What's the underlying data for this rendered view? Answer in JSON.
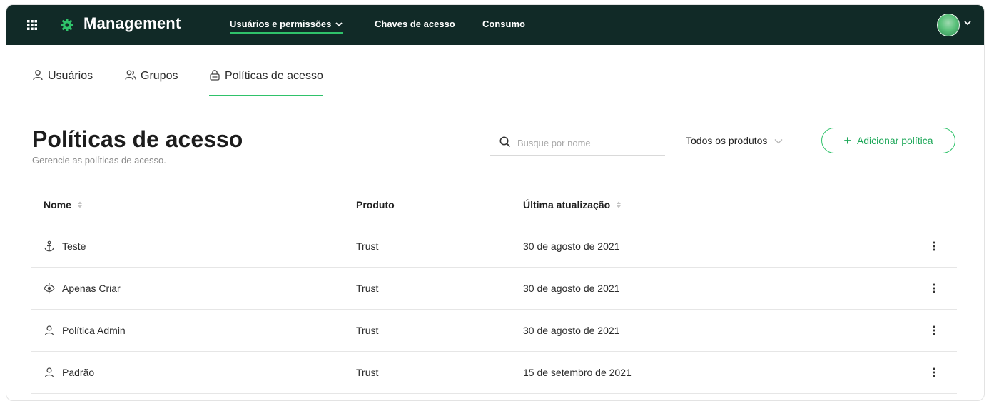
{
  "topbar": {
    "brand": "Management",
    "nav": [
      "Usuários e permissões",
      "Chaves de acesso",
      "Consumo"
    ],
    "colors": {
      "background": "#112a27",
      "accent": "#2fc26a"
    }
  },
  "subtabs": [
    {
      "label": "Usuários",
      "icon": "user-icon"
    },
    {
      "label": "Grupos",
      "icon": "group-icon"
    },
    {
      "label": "Políticas de acesso",
      "icon": "lock-icon",
      "active": true
    }
  ],
  "page": {
    "title": "Políticas de acesso",
    "subtitle": "Gerencie as políticas de acesso."
  },
  "search": {
    "placeholder": "Busque por nome",
    "value": ""
  },
  "filter": {
    "label": "Todos os produtos"
  },
  "add_button": {
    "label": "Adicionar política"
  },
  "table": {
    "columns": [
      "Nome",
      "Produto",
      "Última atualização"
    ],
    "rows": [
      {
        "name": "Teste",
        "icon": "anchor-icon",
        "product": "Trust",
        "updated": "30 de agosto de 2021"
      },
      {
        "name": "Apenas Criar",
        "icon": "eye-gear-icon",
        "product": "Trust",
        "updated": "30 de agosto de 2021"
      },
      {
        "name": "Política Admin",
        "icon": "user-icon",
        "product": "Trust",
        "updated": "30 de agosto de 2021"
      },
      {
        "name": "Padrão",
        "icon": "user-icon",
        "product": "Trust",
        "updated": "15 de setembro de 2021"
      }
    ]
  }
}
